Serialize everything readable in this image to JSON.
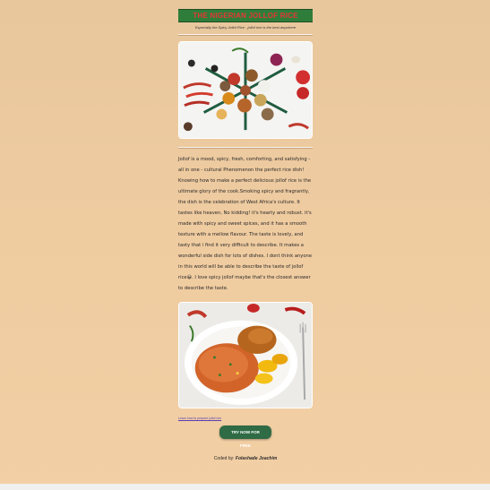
{
  "header": {
    "title": "THE NIGERIAN JOLLOF RICE",
    "subtitle": "Especially the Spicy Jollof Rice - jollof rice is the best anywhere"
  },
  "images": {
    "spices_alt": "spices photo",
    "dish_alt": "jollof rice dish photo"
  },
  "article": {
    "paragraph_before_emoji": "Jollof is a mood, spicy, fresh, comforting, and satisfying - all in one - cultural Phenomenon the perfect rice dish! Knowing how to make a perfect delicious jollof rice is the ultimate glory of the cook.Smoking spicy and fragrantly, the dish is the celebration of West Africa's culture. It tastes like heaven, No kidding! it's hearty and robust. it's made with spicy and sweet spices, and it has a smooth texture with a mellow flavour. The taste is lovely, and tasty that i find it very difficult to describe. It makes a wonderful side dish for lots of dishes. I dont think anyone in this world will be able to describe the taste of jollof rice",
    "emoji": "😀",
    "paragraph_after_emoji": ". I love spicy jollof maybe that's the closest answer to describe the taste."
  },
  "link": {
    "label": "Learn how to prepare jollof rice"
  },
  "cta": {
    "label": "TRY NOW FOR FREE"
  },
  "footer": {
    "coded_by_label": "Coded by:",
    "author": "Folashade Joachim"
  },
  "colors": {
    "title_bar": "#2f7d3a",
    "title_text": "#e53935",
    "button": "#2f6b45",
    "background": "#efcba0"
  }
}
